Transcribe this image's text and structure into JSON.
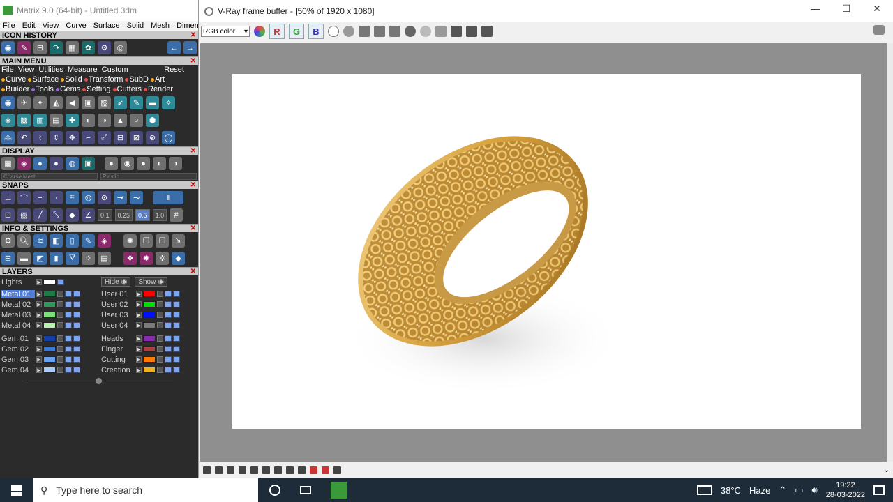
{
  "matrix": {
    "title": "Matrix 9.0 (64-bit) - Untitled.3dm",
    "menubar": [
      "File",
      "Edit",
      "View",
      "Curve",
      "Surface",
      "Solid",
      "Mesh",
      "Dimensio"
    ],
    "sections": {
      "icon_history": "ICON HISTORY",
      "main_menu": "MAIN MENU",
      "display": "DISPLAY",
      "snaps": "SNAPS",
      "info_settings": "INFO & SETTINGS",
      "layers": "LAYERS"
    },
    "main_menu_items": [
      "File",
      "View",
      "Utilities",
      "Measure",
      "Custom"
    ],
    "main_menu_reset": "Reset",
    "categories_row1": [
      "Curve",
      "Surface",
      "Solid",
      "Transform",
      "SubD",
      "Art"
    ],
    "categories_row2": [
      "Builder",
      "Tools",
      "Gems",
      "Setting",
      "Cutters",
      "Render"
    ],
    "display_mesh": "Coarse Mesh",
    "display_material": "Plastic",
    "snap_values": [
      "0.1",
      "0.25",
      "0.5",
      "1.0"
    ],
    "layers": {
      "lights": "Lights",
      "hide": "Hide",
      "show": "Show",
      "left": [
        {
          "name": "Metal 01",
          "color": "#1f7a4a",
          "selected": true
        },
        {
          "name": "Metal 02",
          "color": "#2e9a5a"
        },
        {
          "name": "Metal 03",
          "color": "#7de07d"
        },
        {
          "name": "Metal 04",
          "color": "#b8f0b0"
        },
        {
          "name": "Gem 01",
          "color": "#1540a8"
        },
        {
          "name": "Gem 02",
          "color": "#3a78d8"
        },
        {
          "name": "Gem 03",
          "color": "#6aa2ee"
        },
        {
          "name": "Gem 04",
          "color": "#a8cdf8"
        }
      ],
      "right": [
        {
          "name": "User 01",
          "color": "#ff0000"
        },
        {
          "name": "User 02",
          "color": "#00e000"
        },
        {
          "name": "User 03",
          "color": "#0010ff"
        },
        {
          "name": "User 04",
          "color": "#7a7a7a"
        },
        {
          "name": "Heads",
          "color": "#8a2ab0"
        },
        {
          "name": "Finger",
          "color": "#b04040"
        },
        {
          "name": "Cutting",
          "color": "#ff7a00"
        },
        {
          "name": "Creation",
          "color": "#f0b020"
        }
      ]
    }
  },
  "vray": {
    "title": "V-Ray frame buffer - [50% of 1920 x 1080]",
    "channel": "RGB color",
    "channel_buttons": [
      "R",
      "G",
      "B"
    ],
    "window_controls": [
      "—",
      "☐",
      "✕"
    ]
  },
  "taskbar": {
    "search_placeholder": "Type here to search",
    "weather": "38°C",
    "weather_desc": "Haze",
    "time": "19:22",
    "date": "28-03-2022"
  }
}
